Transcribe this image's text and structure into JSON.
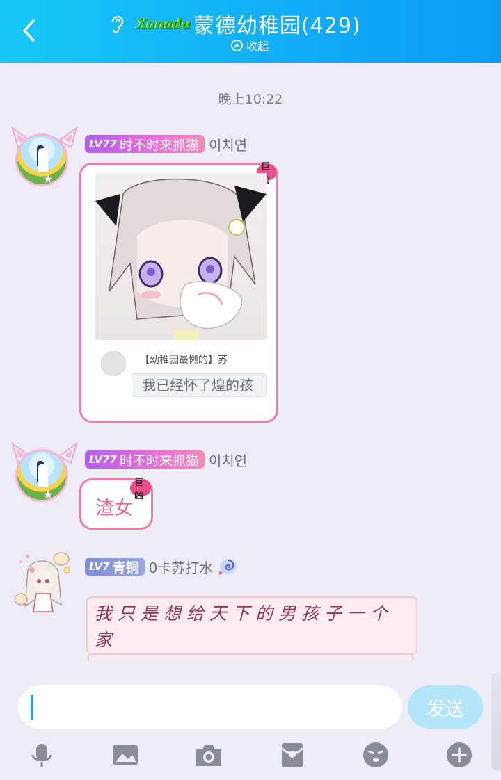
{
  "header": {
    "brand": "Xanadu",
    "group_name": "蒙德幼稚园",
    "member_count": "(429)",
    "collapse_label": "收起"
  },
  "chat": {
    "timestamp": "晚上10:22",
    "messages": [
      {
        "level_badge": "LV77",
        "title": "时不时来抓猫",
        "nickname": "이치연",
        "bubble_tag": "巨凶",
        "quote": {
          "name": "【幼稚园最懒的】苏",
          "text": "我已经怀了煌的孩"
        }
      },
      {
        "level_badge": "LV77",
        "title": "时不时来抓猫",
        "nickname": "이치연",
        "bubble_tag": "巨凶",
        "text": "渣女"
      },
      {
        "level_badge": "LV7",
        "title": "青铜",
        "nickname": "0卡苏打水",
        "note_text": "我只是想给天下的男孩子一个家"
      }
    ]
  },
  "input_bar": {
    "send_label": "发送",
    "tools": [
      "microphone-icon",
      "image-icon",
      "camera-icon",
      "red-packet-icon",
      "emoji-icon",
      "plus-icon"
    ]
  },
  "colors": {
    "header_start": "#18c8f6",
    "header_end": "#0c9cf6",
    "bubble_border": "#f27aa8",
    "send_button": "#b4e6fb",
    "background": "#eeedf7"
  }
}
